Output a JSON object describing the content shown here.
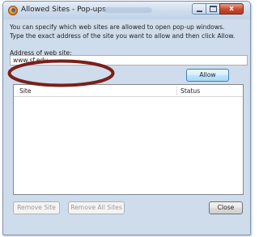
{
  "window": {
    "title": "Allowed Sites - Pop-ups",
    "close_glyph": "x"
  },
  "description": "You can specify which web sites are allowed to open pop-up windows. Type the exact address of the site you want to allow and then click Allow.",
  "address": {
    "label": "Address of web site:",
    "value": "www.sf.edu"
  },
  "buttons": {
    "allow": "Allow",
    "remove_site": "Remove Site",
    "remove_all_sites": "Remove All Sites",
    "close": "Close"
  },
  "list": {
    "columns": [
      "Site",
      "Status"
    ],
    "rows": []
  },
  "colors": {
    "annotation": "#7a1f1a"
  }
}
